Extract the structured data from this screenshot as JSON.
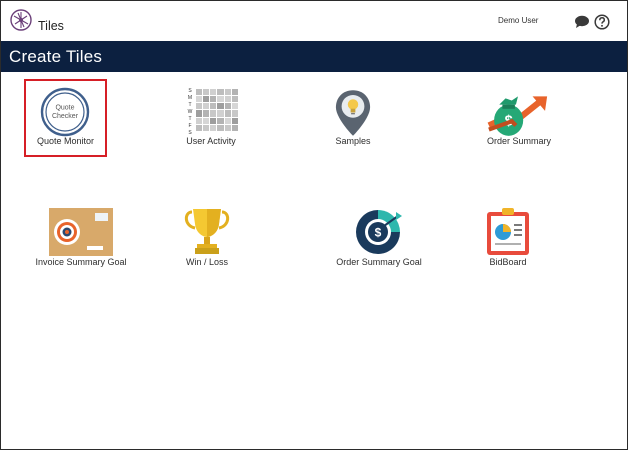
{
  "header": {
    "title": "Tiles",
    "user": "Demo User",
    "icons": [
      "logo-icon",
      "chat-icon",
      "help-icon"
    ]
  },
  "banner": {
    "title": "Create Tiles"
  },
  "tiles": [
    {
      "label": "Quote Monitor",
      "icon": "quote-checker-icon",
      "icon_text": [
        "Quote",
        "Checker"
      ],
      "selected": true
    },
    {
      "label": "User Activity",
      "icon": "calendar-grid-icon",
      "icon_text": [
        "S",
        "M",
        "T",
        "W",
        "T",
        "F",
        "S"
      ]
    },
    {
      "label": "Samples",
      "icon": "map-pin-bulb-icon"
    },
    {
      "label": "Order Summary",
      "icon": "money-bag-arrow-icon"
    },
    {
      "label": "Invoice Summary Goal",
      "icon": "target-envelope-icon"
    },
    {
      "label": "Win / Loss",
      "icon": "trophy-icon"
    },
    {
      "label": "Order Summary Goal",
      "icon": "dollar-target-icon"
    },
    {
      "label": "BidBoard",
      "icon": "clipboard-chart-icon"
    }
  ],
  "colors": {
    "banner": "#0c2040",
    "selection": "#d61f26"
  }
}
